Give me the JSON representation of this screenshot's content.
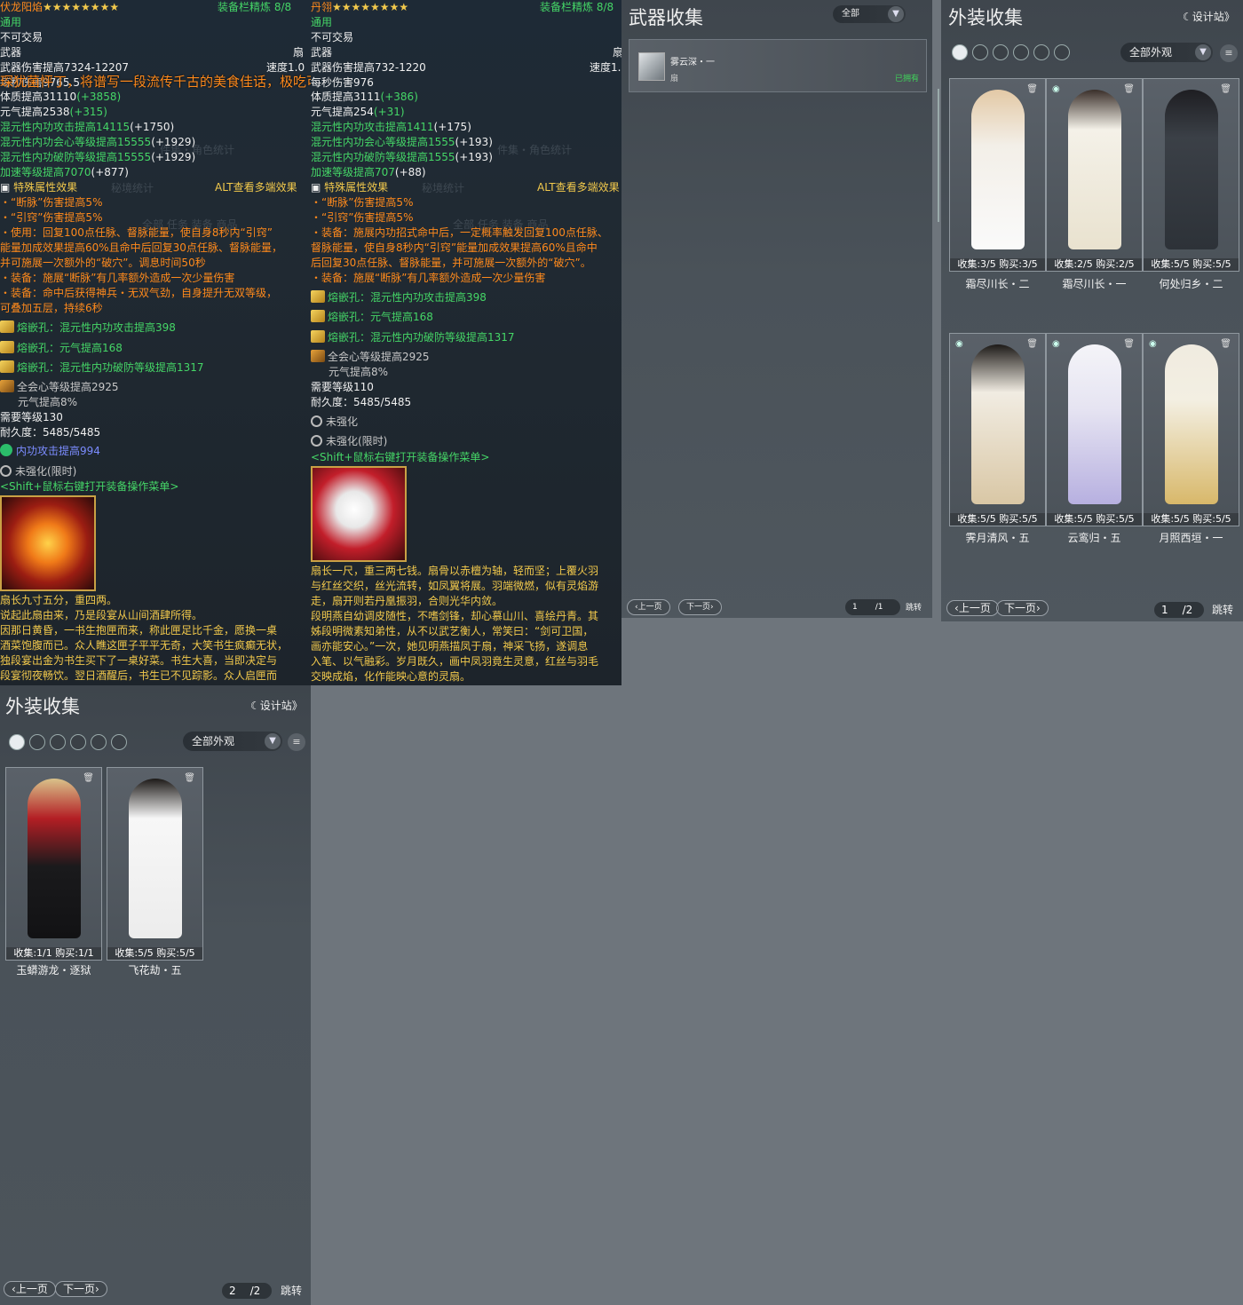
{
  "tooltip1": {
    "name": "伏龙阳焰",
    "stars": "★★★★★★★★",
    "refine": "装备栏精炼 8/8",
    "banner": "琛犹菌怦丁，将谱写一段流传千古的美食佳话，极吃可奇葩成功引起裴草注意，裴草触发奇遇",
    "l_common": "通用",
    "l_notrade": "不可交易",
    "l_weapon": "武器",
    "l_fan": "扇",
    "dmg": "武器伤害提高7324-12207",
    "speed": "速度1.0",
    "dps": "每秒伤害9765.5",
    "con": "体质提高31110",
    "con_b": "(+3858)",
    "yuan": "元气提高2538",
    "yuan_b": "(+315)",
    "atk": "混元性内功攻击提高14115",
    "atk_b": "(+1750)",
    "crit": "混元性内功会心等级提高15555",
    "crit_b": "(+1929)",
    "pen": "混元性内功破防等级提高15555",
    "pen_b": "(+1929)",
    "haste": "加速等级提高7070",
    "haste_b": "(+877)",
    "special": "特殊属性效果",
    "alt": "ALT查看多端效果",
    "s1": "・“断脉”伤害提高5%",
    "s2": "・“引窍”伤害提高5%",
    "s3": "・使用：回复100点任脉、督脉能量，使自身8秒内“引窍”",
    "s3b": "能量加成效果提高60%且命中后回复30点任脉、督脉能量，",
    "s3c": "并可施展一次额外的“破穴”。调息时间50秒",
    "s4": "・装备：施展“断脉”有几率额外造成一次少量伤害",
    "s5": "・装备：命中后获得神兵・无双气劲，自身提升无双等级，",
    "s5b": "可叠加五层，持续6秒",
    "g1": "熔嵌孔：混元性内功攻击提高398",
    "g2": "熔嵌孔：元气提高168",
    "g3": "熔嵌孔：混元性内功破防等级提高1317",
    "set1": "全会心等级提高2925",
    "set2": "元气提高8%",
    "req": "需要等级130",
    "dur": "耐久度：5485/5485",
    "enchant": "内功攻击提高994",
    "unenh": "未强化(限时)",
    "hint": "<Shift+鼠标右键打开装备操作菜单>",
    "d1": "扇长九寸五分，重四两。",
    "d2": "说起此扇由来，乃是段宴从山间酒肆所得。",
    "d3": "因那日黄昏，一书生抱匣而来，称此匣足比千金，愿换一桌",
    "d4": "酒菜饱腹而已。众人瞧这匣子平平无奇，大笑书生疯癫无状，",
    "d5": "独段宴出金为书生买下了一桌好菜。书生大喜，当即决定与",
    "d6": "段宴彻夜畅饮。翌日酒醒后，书生已不见踪影。众人启匣而",
    "ghost1": "件集・角色统计",
    "ghost2": "秘境统计",
    "ghost3": "任务",
    "ghost4": "全部  任务  装备  商品"
  },
  "tooltip2": {
    "name": "丹翎",
    "stars": "★★★★★★★★",
    "refine": "装备栏精炼 8/8",
    "l_common": "通用",
    "l_notrade": "不可交易",
    "l_weapon": "武器",
    "l_fan": "扇",
    "dmg": "武器伤害提高732-1220",
    "speed": "速度1.",
    "dps": "每秒伤害976",
    "con": "体质提高3111",
    "con_b": "(+386)",
    "yuan": "元气提高254",
    "yuan_b": "(+31)",
    "atk": "混元性内功攻击提高1411",
    "atk_b": "(+175)",
    "crit": "混元性内功会心等级提高1555",
    "crit_b": "(+193)",
    "pen": "混元性内功破防等级提高1555",
    "pen_b": "(+193)",
    "haste": "加速等级提高707",
    "haste_b": "(+88)",
    "special": "特殊属性效果",
    "alt": "ALT查看多端效果",
    "s1": "・“断脉”伤害提高5%",
    "s2": "・“引窍”伤害提高5%",
    "s3": "・装备：施展内功招式命中后，一定概率触发回复100点任脉、",
    "s3b": "督脉能量，使自身8秒内“引窍”能量加成效果提高60%且命中",
    "s3c": "后回复30点任脉、督脉能量，并可施展一次额外的“破穴”。",
    "s4": "・装备：施展“断脉”有几率额外造成一次少量伤害",
    "g1": "熔嵌孔：混元性内功攻击提高398",
    "g2": "熔嵌孔：元气提高168",
    "g3": "熔嵌孔：混元性内功破防等级提高1317",
    "set1": "全会心等级提高2925",
    "set2": "元气提高8%",
    "req": "需要等级110",
    "dur": "耐久度：5485/5485",
    "unenh1": "未强化",
    "unenh2": "未强化(限时)",
    "hint": "<Shift+鼠标右键打开装备操作菜单>",
    "d1": "扇长一尺，重三两七钱。扇骨以赤檀为轴，轻而坚；上覆火羽",
    "d2": "与红丝交织，丝光流转，如凤翼将展。羽端微燃，似有灵焰游",
    "d3": "走，扇开则若丹凰振羽，合则光华内敛。",
    "d4": "段明燕自幼调皮随性，不嗜剑锋，却心慕山川、喜绘丹青。其",
    "d5": "姊段明微素知弟性，从不以武艺衡人，常笑曰：“剑可卫国，",
    "d6": "画亦能安心。”一次，她见明燕描凤于扇，神采飞扬，遂调息",
    "d7": "入笔、以气融彩。岁月既久，画中凤羽竟生灵意，红丝与羽毛",
    "d8": "交映成焰，化作能映心意的灵扇。",
    "ghost1": "件集・角色统计",
    "ghost2": "秘境统计",
    "ghost3": "任务",
    "ghost4": "全部  任务  装备  商品"
  },
  "weapon_panel": {
    "title": "武器收集",
    "filter": "全部",
    "item_name": "雾云深・一",
    "item_type": "扇",
    "item_status": "已拥有",
    "prev": "上一页",
    "next": "下一页",
    "page": "1",
    "total": "/1",
    "jump": "跳转"
  },
  "outfit_panel_a": {
    "title": "外装收集",
    "design": "设计站》",
    "filter": "全部外观",
    "cards": [
      {
        "count": "收集:3/5 购买:3/5",
        "name": "霜尽川长・二"
      },
      {
        "count": "收集:2/5 购买:2/5",
        "name": "霜尽川长・一"
      },
      {
        "count": "收集:5/5 购买:5/5",
        "name": "何处归乡・二"
      },
      {
        "count": "收集:5/5 购买:5/5",
        "name": "霁月清风・五"
      },
      {
        "count": "收集:5/5 购买:5/5",
        "name": "云鸾归・五"
      },
      {
        "count": "收集:5/5 购买:5/5",
        "name": "月照西垣・一"
      }
    ],
    "prev": "上一页",
    "next": "下一页",
    "page": "1",
    "total": "/2",
    "jump": "跳转"
  },
  "outfit_panel_b": {
    "title": "外装收集",
    "design": "设计站》",
    "filter": "全部外观",
    "cards": [
      {
        "count": "收集:1/1 购买:1/1",
        "name": "玉蟒游龙・逐狱"
      },
      {
        "count": "收集:5/5 购买:5/5",
        "name": "飞花劫・五"
      }
    ],
    "prev": "上一页",
    "next": "下一页",
    "page": "2",
    "total": "/2",
    "jump": "跳转"
  }
}
